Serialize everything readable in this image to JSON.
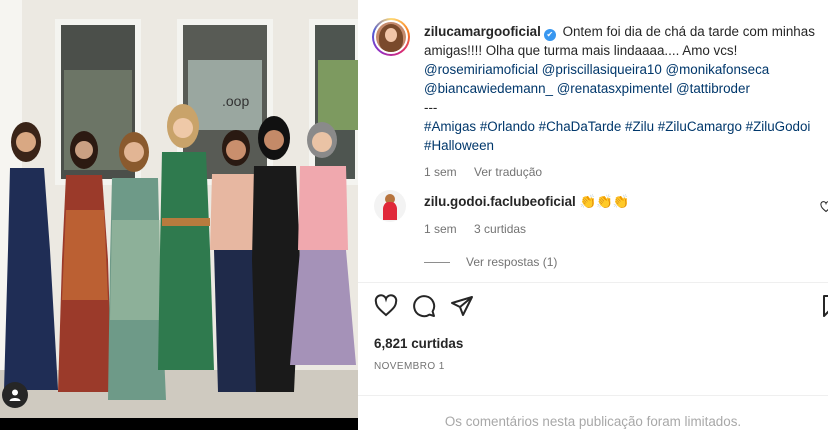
{
  "post": {
    "username": "zilucamargooficial",
    "verified_mark": "✔",
    "caption": "Ontem foi dia de chá da tarde com minhas amigas!!!! Olha que turma mais lindaaaa.... Amo vcs!",
    "mentions": [
      "@rosemiriamoficial",
      "@priscillasiqueira10",
      "@monikafonseca",
      "@biancawiedemann_",
      "@renatasxpimentel",
      "@tattibroder"
    ],
    "separator": "---",
    "hashtags": [
      "#Amigas",
      "#Orlando",
      "#ChaDaTarde",
      "#Zilu",
      "#ZiluCamargo",
      "#ZiluGodoi",
      "#Halloween"
    ],
    "age": "1 sem",
    "translate_label": "Ver tradução"
  },
  "comment": {
    "username": "zilu.godoi.faclubeoficial",
    "text": "👏👏👏",
    "age": "1 sem",
    "likes": "3 curtidas",
    "view_replies": "Ver respostas (1)"
  },
  "footer": {
    "likes": "6,821 curtidas",
    "date": "NOVEMBRO 1",
    "comments_limited": "Os comentários nesta publicação foram limitados."
  },
  "icons": {
    "like": "heart-icon",
    "comment": "comment-icon",
    "share": "share-icon",
    "save": "bookmark-icon",
    "tagged_users": "user-tag-icon"
  },
  "colors": {
    "link": "#00376b",
    "verified": "#3897f0",
    "muted": "#737373"
  }
}
